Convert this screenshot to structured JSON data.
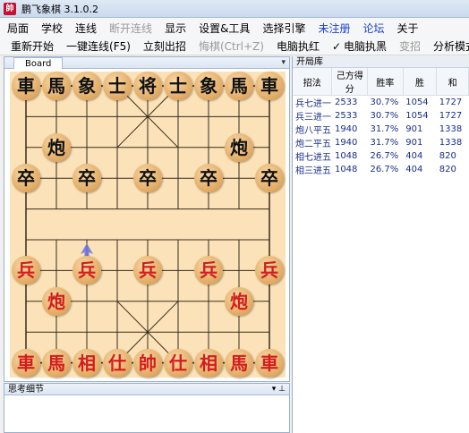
{
  "titlebar": {
    "title": "鹏飞象棋 3.1.0.2",
    "icon_text": "帥"
  },
  "menu": [
    {
      "label": "局面",
      "state": "normal"
    },
    {
      "label": "学校",
      "state": "normal"
    },
    {
      "label": "连线",
      "state": "normal"
    },
    {
      "label": "断开连线",
      "state": "disabled"
    },
    {
      "label": "显示",
      "state": "normal"
    },
    {
      "label": "设置&工具",
      "state": "normal"
    },
    {
      "label": "选择引擎",
      "state": "normal"
    },
    {
      "label": "未注册",
      "state": "link"
    },
    {
      "label": "论坛",
      "state": "link"
    },
    {
      "label": "关于",
      "state": "normal"
    }
  ],
  "toolbar": {
    "restart": "重新开始",
    "quick_connect": "一键连线(F5)",
    "move_now": "立刻出招",
    "undo": "悔棋(Ctrl+Z)",
    "cpu_red": "电脑执红",
    "cpu_black": "电脑执黑",
    "cpu_black_check": "✓",
    "change_move": "变招",
    "analysis": "分析模式"
  },
  "board_panel": {
    "tab_label": "Board",
    "pin": "▾"
  },
  "pieces": [
    {
      "char": "車",
      "side": "black",
      "file": 0,
      "rank": 0
    },
    {
      "char": "馬",
      "side": "black",
      "file": 1,
      "rank": 0
    },
    {
      "char": "象",
      "side": "black",
      "file": 2,
      "rank": 0
    },
    {
      "char": "士",
      "side": "black",
      "file": 3,
      "rank": 0
    },
    {
      "char": "将",
      "side": "black",
      "file": 4,
      "rank": 0
    },
    {
      "char": "士",
      "side": "black",
      "file": 5,
      "rank": 0
    },
    {
      "char": "象",
      "side": "black",
      "file": 6,
      "rank": 0
    },
    {
      "char": "馬",
      "side": "black",
      "file": 7,
      "rank": 0
    },
    {
      "char": "車",
      "side": "black",
      "file": 8,
      "rank": 0
    },
    {
      "char": "炮",
      "side": "black",
      "file": 1,
      "rank": 2
    },
    {
      "char": "炮",
      "side": "black",
      "file": 7,
      "rank": 2
    },
    {
      "char": "卒",
      "side": "black",
      "file": 0,
      "rank": 3
    },
    {
      "char": "卒",
      "side": "black",
      "file": 2,
      "rank": 3
    },
    {
      "char": "卒",
      "side": "black",
      "file": 4,
      "rank": 3
    },
    {
      "char": "卒",
      "side": "black",
      "file": 6,
      "rank": 3
    },
    {
      "char": "卒",
      "side": "black",
      "file": 8,
      "rank": 3
    },
    {
      "char": "兵",
      "side": "red",
      "file": 0,
      "rank": 6
    },
    {
      "char": "兵",
      "side": "red",
      "file": 2,
      "rank": 6
    },
    {
      "char": "兵",
      "side": "red",
      "file": 4,
      "rank": 6
    },
    {
      "char": "兵",
      "side": "red",
      "file": 6,
      "rank": 6
    },
    {
      "char": "兵",
      "side": "red",
      "file": 8,
      "rank": 6
    },
    {
      "char": "炮",
      "side": "red",
      "file": 1,
      "rank": 7
    },
    {
      "char": "炮",
      "side": "red",
      "file": 7,
      "rank": 7
    },
    {
      "char": "車",
      "side": "red",
      "file": 0,
      "rank": 9
    },
    {
      "char": "馬",
      "side": "red",
      "file": 1,
      "rank": 9
    },
    {
      "char": "相",
      "side": "red",
      "file": 2,
      "rank": 9
    },
    {
      "char": "仕",
      "side": "red",
      "file": 3,
      "rank": 9
    },
    {
      "char": "帥",
      "side": "red",
      "file": 4,
      "rank": 9
    },
    {
      "char": "仕",
      "side": "red",
      "file": 5,
      "rank": 9
    },
    {
      "char": "相",
      "side": "red",
      "file": 6,
      "rank": 9
    },
    {
      "char": "馬",
      "side": "red",
      "file": 7,
      "rank": 9
    },
    {
      "char": "車",
      "side": "red",
      "file": 8,
      "rank": 9
    }
  ],
  "move_hint": {
    "file": 2,
    "from_rank": 6,
    "to_rank": 5,
    "color": "#6a6ee0"
  },
  "opening_book": {
    "title": "开局库",
    "columns": [
      "招法",
      "己方得分",
      "胜率",
      "胜",
      "和"
    ],
    "rows": [
      [
        "兵七进一",
        "2533",
        "30.7%",
        "1054",
        "1727"
      ],
      [
        "兵三进一",
        "2533",
        "30.7%",
        "1054",
        "1727"
      ],
      [
        "炮八平五",
        "1940",
        "31.7%",
        "901",
        "1338"
      ],
      [
        "炮二平五",
        "1940",
        "31.7%",
        "901",
        "1338"
      ],
      [
        "相七进五",
        "1048",
        "26.7%",
        "404",
        "820"
      ],
      [
        "相三进五",
        "1048",
        "26.7%",
        "404",
        "820"
      ]
    ]
  },
  "think_panel": {
    "title": "思考细节",
    "controls": "▾ ⊥"
  },
  "colors": {
    "board": "#fbe2b9",
    "line": "#3a2a1a",
    "red_piece": "#d41c1c",
    "black_piece": "#111111"
  }
}
